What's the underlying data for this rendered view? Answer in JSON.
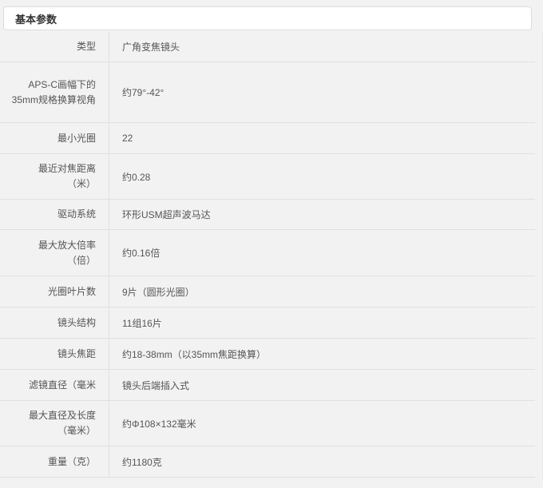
{
  "section": {
    "title": "基本参数"
  },
  "rows": [
    {
      "label": "类型",
      "value": "广角变焦镜头"
    },
    {
      "label": "APS-C画幅下的35mm规格换算视角",
      "value": "约79°-42°"
    },
    {
      "label": "最小光圈",
      "value": "22"
    },
    {
      "label": "最近对焦距离（米）",
      "value": "约0.28"
    },
    {
      "label": "驱动系统",
      "value": "环形USM超声波马达"
    },
    {
      "label": "最大放大倍率（倍）",
      "value": "约0.16倍"
    },
    {
      "label": "光圈叶片数",
      "value": "9片（圆形光圈）"
    },
    {
      "label": "镜头结构",
      "value": "11组16片"
    },
    {
      "label": "镜头焦距",
      "value": "约18-38mm（以35mm焦距换算）"
    },
    {
      "label": "滤镜直径（毫米",
      "value": "镜头后端插入式"
    },
    {
      "label": "最大直径及长度（毫米）",
      "value": "约Φ108×132毫米"
    },
    {
      "label": "重量（克）",
      "value": "约1180克"
    }
  ]
}
